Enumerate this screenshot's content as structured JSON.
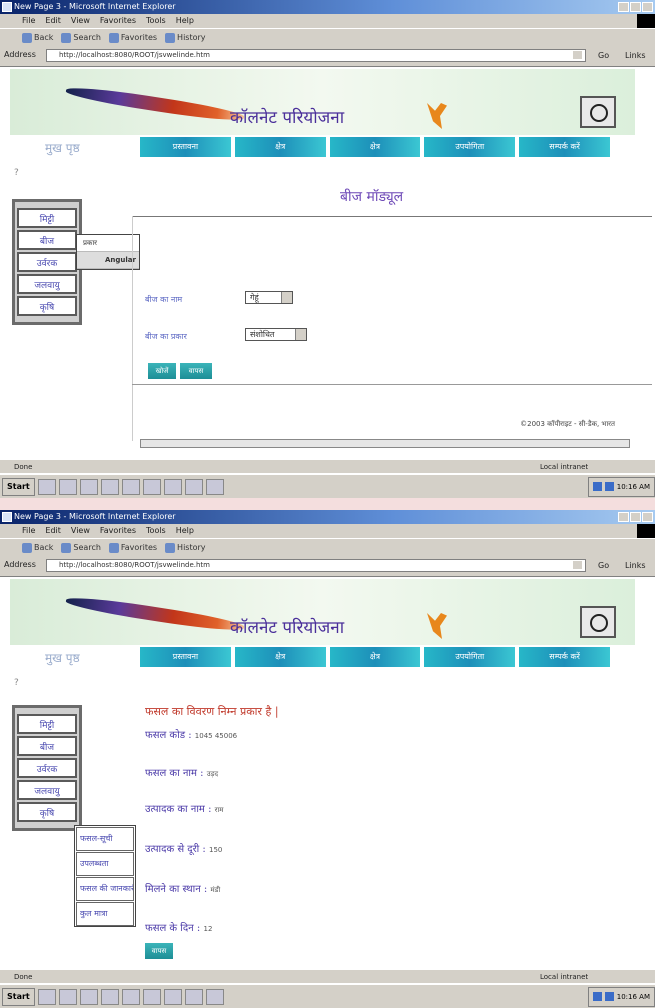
{
  "browser": {
    "window_title": "New Page 3 - Microsoft Internet Explorer",
    "menu": [
      "File",
      "Edit",
      "View",
      "Favorites",
      "Tools",
      "Help"
    ],
    "toolbar": [
      "Back",
      "Search",
      "Favorites",
      "History"
    ],
    "address_label": "Address",
    "url": "http://localhost:8080/ROOT/jsvwelinde.htm",
    "go_label": "Go",
    "links_label": "Links",
    "status_done": "Done",
    "status_zone": "Local intranet",
    "taskbar_start": "Start",
    "clock": "10:16 AM"
  },
  "site": {
    "title": "कॉलनेट परियोजना",
    "home_link": "मुख पृष्ठ",
    "nav_tabs": [
      "प्रस्तावना",
      "क्षेत्र",
      "क्षेत्र",
      "उपयोगिता",
      "सम्पर्क करें"
    ],
    "side_menu": [
      "मिट्टी",
      "बीज",
      "उर्वरक",
      "जलवायु",
      "कृषि"
    ],
    "copyright": "©2003 कॉपीराइट - सी-डैक, भारत"
  },
  "screen1": {
    "heading": "बीज मॉड्यूल",
    "flyout": [
      "प्रकार",
      "Angular"
    ],
    "field1_label": "बीज का नाम",
    "field1_value": "गेहूं",
    "field2_label": "बीज का प्रकार",
    "field2_value": "संशोधित",
    "buttons": [
      "खोजें",
      "वापस"
    ]
  },
  "screen2": {
    "heading": "फसल का विवरण निम्न प्रकार है |",
    "rows": [
      {
        "label": "फसल कोड :",
        "value": "1045 45006"
      },
      {
        "label": "फसल का नाम :",
        "value": "उड़द"
      },
      {
        "label": "उत्पादक का नाम :",
        "value": "राम"
      },
      {
        "label": "उत्पादक से दूरी :",
        "value": "150"
      },
      {
        "label": "मिलने का स्थान :",
        "value": "मंडी"
      },
      {
        "label": "फसल के दिन :",
        "value": "12"
      }
    ],
    "flyout": [
      "फसल-सूची",
      "उपलब्धता",
      "फसल की जानकारी",
      "कुल मात्रा"
    ],
    "button": "वापस"
  },
  "colors": {
    "nav_teal": "#27b7c8",
    "title_purple": "#4a2f9a",
    "heading_red": "#c0392b"
  }
}
